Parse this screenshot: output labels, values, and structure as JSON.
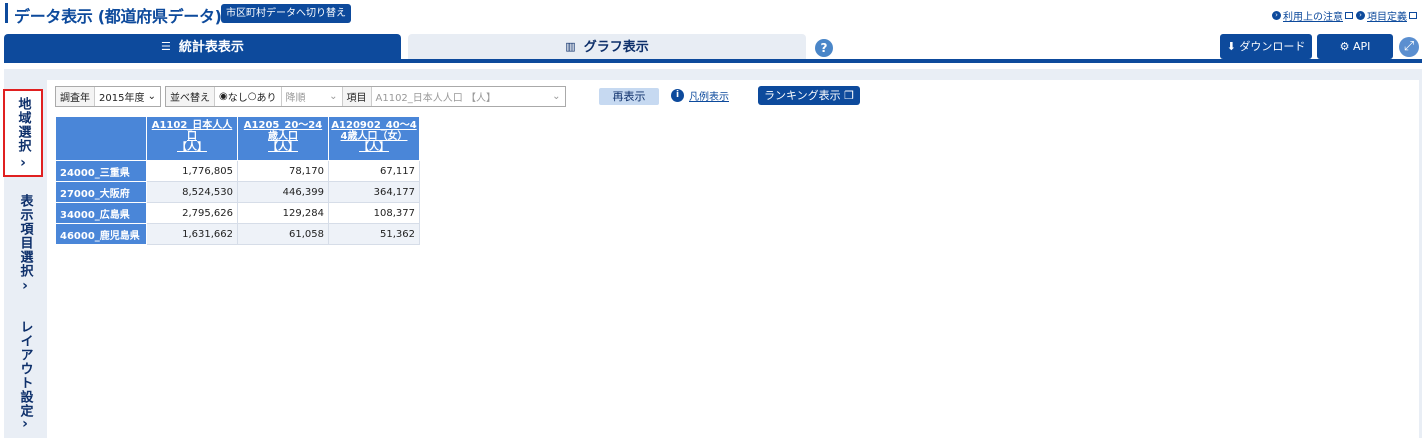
{
  "header": {
    "title": "データ表示 (都道府県データ)",
    "switch_button": "市区町村データへ切り替え",
    "links": [
      "利用上の注意",
      "項目定義"
    ]
  },
  "tabs": {
    "table_tab": "統計表表示",
    "graph_tab": "グラフ表示",
    "help_icon": "?"
  },
  "actions": {
    "download": "ダウンロード",
    "api": "API"
  },
  "side_tabs": {
    "region": "地域選択",
    "items": "表示項目選択",
    "layout": "レイアウト設定"
  },
  "filter": {
    "year_label": "調査年",
    "year_value": "2015年度",
    "sort_label": "並べ替え",
    "sort_none": "なし",
    "sort_yes": "あり",
    "order_value": "降順",
    "item_label": "項目",
    "item_value": "A1102_日本人人口 【人】",
    "redisplay": "再表示",
    "legend": "凡例表示",
    "ranking": "ランキング表示"
  },
  "table": {
    "columns": [
      [
        "A1102_日本人人",
        "口",
        "【人】"
      ],
      [
        "A1205_20～24",
        "歳人口",
        "【人】"
      ],
      [
        "A120902_40～4",
        "4歳人口（女）",
        "【人】"
      ]
    ],
    "rows": [
      {
        "region": "24000_三重県",
        "values": [
          "1,776,805",
          "78,170",
          "67,117"
        ]
      },
      {
        "region": "27000_大阪府",
        "values": [
          "8,524,530",
          "446,399",
          "364,177"
        ]
      },
      {
        "region": "34000_広島県",
        "values": [
          "2,795,626",
          "129,284",
          "108,377"
        ]
      },
      {
        "region": "46000_鹿児島県",
        "values": [
          "1,631,662",
          "61,058",
          "51,362"
        ]
      }
    ]
  },
  "colors": {
    "primary": "#0d4a9c",
    "header_cell": "#4a86d8",
    "highlight_border": "#e02020"
  }
}
